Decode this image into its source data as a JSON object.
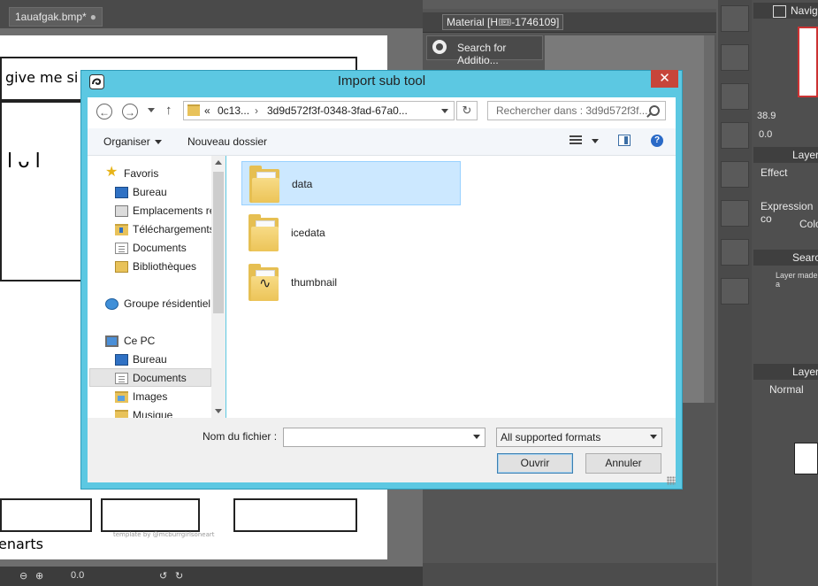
{
  "document_tab": {
    "label": "1auafgak.bmp*",
    "modified_dot": "●"
  },
  "canvas": {
    "top_text": "give me si",
    "face_text": "lᴗl",
    "bottom_text": "enarts",
    "credit": "template by @mcburrgirlsoneart",
    "zoom_value": "0.0"
  },
  "material_panel": {
    "title": "Material [H🎟-1746109]",
    "search_label": "Search for Additio..."
  },
  "right_panel": {
    "navigator": "Navig",
    "zoom_value": "38.9",
    "angle_value": "0.0",
    "layer_property": "Layer",
    "effect": "Effect",
    "expression": "Expression co",
    "color": "Colo",
    "search": "Search",
    "layer_made": "Layer made a",
    "layer": "Layer",
    "blend_mode": "Normal"
  },
  "dialog": {
    "title": "Import sub tool",
    "close_glyph": "✕",
    "breadcrumb": {
      "prefix": "«",
      "segments": [
        "0c13...",
        "3d9d572f3f-0348-3fad-67a0..."
      ],
      "separator": "›"
    },
    "search_placeholder": "Rechercher dans : 3d9d572f3f...",
    "toolbar": {
      "organize": "Organiser",
      "new_folder": "Nouveau dossier",
      "help_glyph": "?"
    },
    "nav_tree": [
      {
        "label": "Favoris",
        "icon": "star-icon"
      },
      {
        "label": "Bureau",
        "icon": "desktop-icon"
      },
      {
        "label": "Emplacements ré",
        "icon": "recent-places-icon"
      },
      {
        "label": "Téléchargements",
        "icon": "downloads-icon"
      },
      {
        "label": "Documents",
        "icon": "document-icon"
      },
      {
        "label": "Bibliothèques",
        "icon": "library-icon"
      },
      {
        "label": "Groupe résidentiel",
        "icon": "homegroup-icon"
      },
      {
        "label": "Ce PC",
        "icon": "computer-icon"
      },
      {
        "label": "Bureau",
        "icon": "desktop-icon"
      },
      {
        "label": "Documents",
        "icon": "document-icon",
        "selected": true
      },
      {
        "label": "Images",
        "icon": "pictures-icon"
      },
      {
        "label": "Musique",
        "icon": "music-icon"
      }
    ],
    "files": [
      {
        "name": "data",
        "selected": true
      },
      {
        "name": "icedata"
      },
      {
        "name": "thumbnail",
        "preview": "∿"
      }
    ],
    "filename_label": "Nom du fichier :",
    "filename_value": "",
    "format_value": "All supported formats",
    "open_label": "Ouvrir",
    "cancel_label": "Annuler",
    "colors": {
      "frame": "#5cc8e2",
      "close": "#c7453a",
      "selection": "#cce8ff"
    }
  }
}
